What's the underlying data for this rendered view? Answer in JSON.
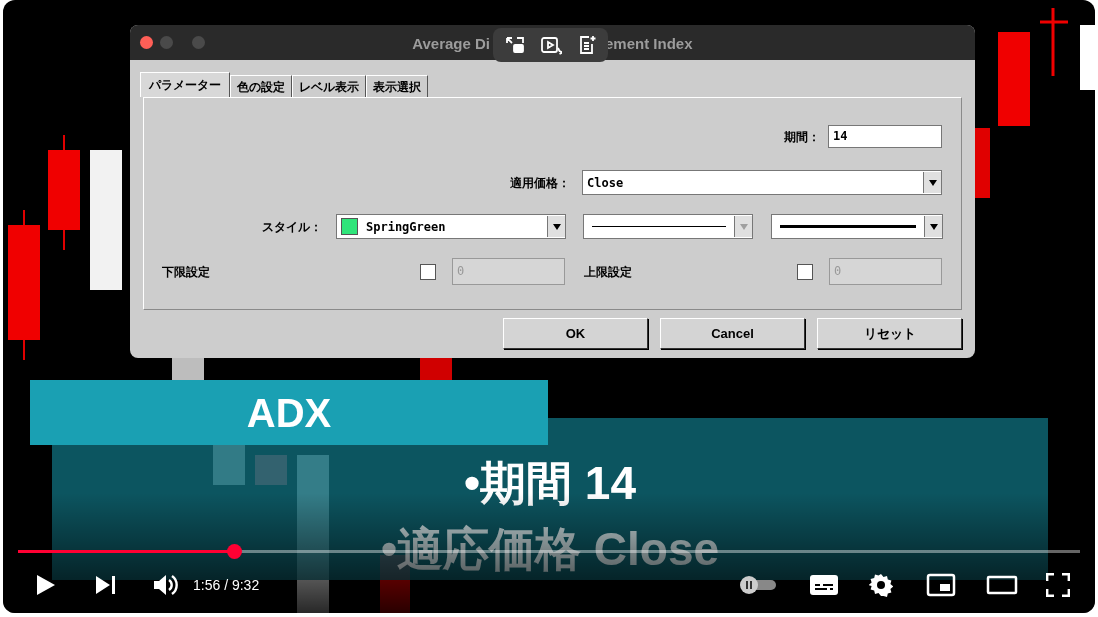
{
  "video": {
    "dialog": {
      "title_left": "Average Di",
      "title_right": "ement Index",
      "tabs": [
        {
          "label": "パラメーター",
          "selected": true
        },
        {
          "label": "色の設定",
          "selected": false
        },
        {
          "label": "レベル表示",
          "selected": false
        },
        {
          "label": "表示選択",
          "selected": false
        }
      ],
      "period": {
        "label": "期間：",
        "value": "14"
      },
      "applied_price": {
        "label": "適用価格：",
        "value": "Close"
      },
      "style": {
        "label": "スタイル：",
        "color_name": "SpringGreen",
        "color": "#2fe57a",
        "line_style_disabled": true
      },
      "levels": [
        {
          "label": "下限設定",
          "checked": false,
          "value": "0"
        },
        {
          "label": "上限設定",
          "checked": false,
          "value": "0"
        }
      ],
      "buttons": [
        "OK",
        "Cancel",
        "リセット"
      ]
    },
    "captions": {
      "heading": "ADX",
      "lines": [
        "•期間 14",
        "•適応価格 Close"
      ]
    }
  },
  "player": {
    "progress": {
      "level": 0.203
    },
    "time": "1:56 / 9:32"
  }
}
